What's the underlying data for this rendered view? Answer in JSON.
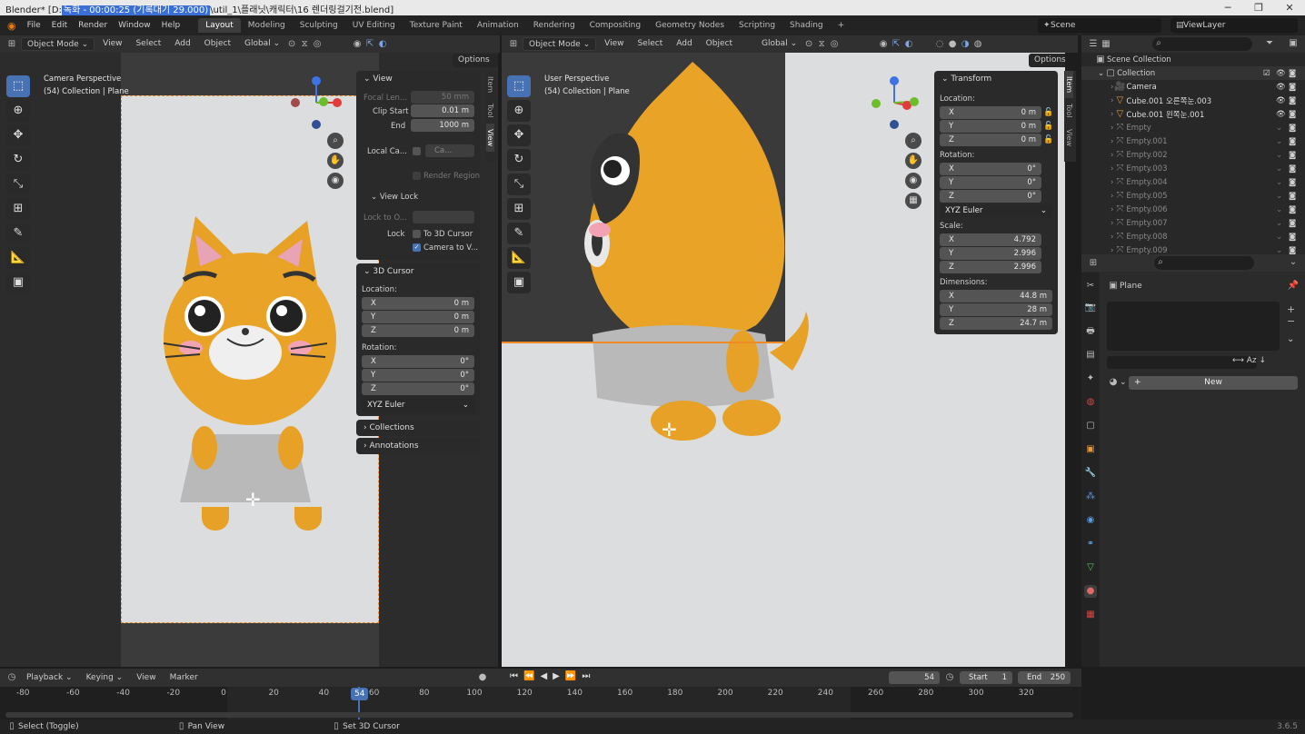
{
  "window": {
    "title_prefix": "Blender* [D:",
    "title_highlight": "녹화 - 00:00:25 (기록대기 29.000)",
    "title_suffix": "\\util_1\\플래닛\\캐릭터\\16 렌더링걸기전.blend]",
    "minimize": "─",
    "maximize": "❐",
    "close": "✕"
  },
  "menus": [
    "File",
    "Edit",
    "Render",
    "Window",
    "Help"
  ],
  "workspaces": [
    "Layout",
    "Modeling",
    "Sculpting",
    "UV Editing",
    "Texture Paint",
    "Animation",
    "Rendering",
    "Compositing",
    "Geometry Nodes",
    "Scripting",
    "Shading"
  ],
  "active_workspace": "Layout",
  "scene_name": "Scene",
  "view_layer": "ViewLayer",
  "left_view": {
    "mode": "Object Mode",
    "menus": [
      "View",
      "Select",
      "Add",
      "Object"
    ],
    "orientation": "Global",
    "options": "Options",
    "perspective": "Camera Perspective",
    "collection": "(54) Collection | Plane",
    "npanel": {
      "view_title": "View",
      "focal_length_label": "Focal Len...",
      "focal_length": "50 mm",
      "clip_start_label": "Clip Start",
      "clip_start": "0.01 m",
      "clip_end_label": "End",
      "clip_end": "1000 m",
      "local_camera_label": "Local Ca...",
      "local_camera_value": "Ca...",
      "render_region": "Render Region",
      "view_lock_title": "View Lock",
      "lock_to_object": "Lock to O...",
      "lock_label": "Lock",
      "to_3d_cursor": "To 3D Cursor",
      "camera_to_view": "Camera to V...",
      "cursor_title": "3D Cursor",
      "location_label": "Location:",
      "loc": [
        {
          "axis": "X",
          "value": "0 m"
        },
        {
          "axis": "Y",
          "value": "0 m"
        },
        {
          "axis": "Z",
          "value": "0 m"
        }
      ],
      "rotation_label": "Rotation:",
      "rot": [
        {
          "axis": "X",
          "value": "0°"
        },
        {
          "axis": "Y",
          "value": "0°"
        },
        {
          "axis": "Z",
          "value": "0°"
        }
      ],
      "rotation_mode": "XYZ Euler",
      "collections": "Collections",
      "annotations": "Annotations"
    },
    "tabs": [
      "Item",
      "Tool",
      "View"
    ]
  },
  "right_view": {
    "mode": "Object Mode",
    "menus": [
      "View",
      "Select",
      "Add",
      "Object"
    ],
    "orientation": "Global",
    "options": "Options",
    "perspective": "User Perspective",
    "collection": "(54) Collection | Plane",
    "transform": {
      "title": "Transform",
      "location_label": "Location:",
      "loc": [
        {
          "axis": "X",
          "value": "0 m"
        },
        {
          "axis": "Y",
          "value": "0 m"
        },
        {
          "axis": "Z",
          "value": "0 m"
        }
      ],
      "rotation_label": "Rotation:",
      "rot": [
        {
          "axis": "X",
          "value": "0°"
        },
        {
          "axis": "Y",
          "value": "0°"
        },
        {
          "axis": "Z",
          "value": "0°"
        }
      ],
      "rotation_mode": "XYZ Euler",
      "scale_label": "Scale:",
      "scale": [
        {
          "axis": "X",
          "value": "4.792"
        },
        {
          "axis": "Y",
          "value": "2.996"
        },
        {
          "axis": "Z",
          "value": "2.996"
        }
      ],
      "dimensions_label": "Dimensions:",
      "dims": [
        {
          "axis": "X",
          "value": "44.8 m"
        },
        {
          "axis": "Y",
          "value": "28 m"
        },
        {
          "axis": "Z",
          "value": "24.7 m"
        }
      ]
    },
    "tabs": [
      "Item",
      "Tool",
      "View"
    ]
  },
  "outliner": {
    "root": "Scene Collection",
    "collection": "Collection",
    "items": [
      "Camera",
      "Cube.001 오른쪽눈.003",
      "Cube.001 왼쪽눈.001",
      "Empty",
      "Empty.001",
      "Empty.002",
      "Empty.003",
      "Empty.004",
      "Empty.005",
      "Empty.006",
      "Empty.007",
      "Empty.008",
      "Empty.009"
    ]
  },
  "properties": {
    "object_name": "Plane",
    "new_button": "New"
  },
  "timeline": {
    "menus": [
      "Playback",
      "Keying",
      "View",
      "Marker"
    ],
    "current_frame": "54",
    "start_label": "Start",
    "start": "1",
    "end_label": "End",
    "end": "250",
    "ticks": [
      "-80",
      "-60",
      "-40",
      "-20",
      "0",
      "20",
      "40",
      "60",
      "80",
      "100",
      "120",
      "140",
      "160",
      "180",
      "200",
      "220",
      "240",
      "260",
      "280",
      "300",
      "320"
    ],
    "playhead": "54"
  },
  "status": {
    "select": "Select (Toggle)",
    "pan": "Pan View",
    "cursor": "Set 3D Cursor",
    "version": "3.6.5"
  },
  "colors": {
    "accent": "#4772b3",
    "cat_yellow": "#e7a126",
    "selection_orange": "#f08a24"
  }
}
